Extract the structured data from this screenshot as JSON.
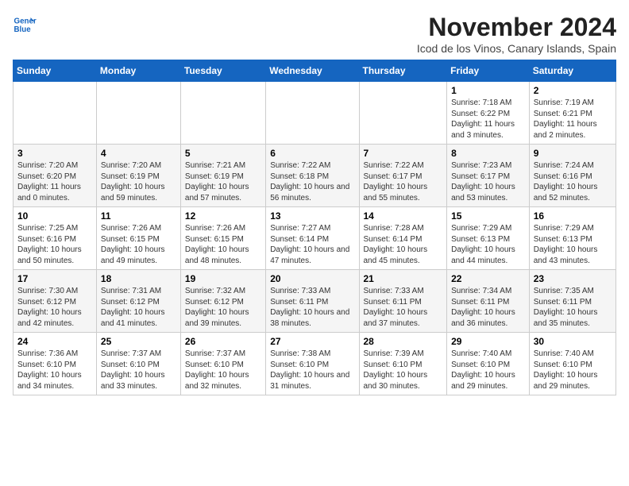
{
  "header": {
    "logo": {
      "line1": "General",
      "line2": "Blue"
    },
    "month": "November 2024",
    "location": "Icod de los Vinos, Canary Islands, Spain"
  },
  "weekdays": [
    "Sunday",
    "Monday",
    "Tuesday",
    "Wednesday",
    "Thursday",
    "Friday",
    "Saturday"
  ],
  "weeks": [
    [
      {
        "day": "",
        "info": ""
      },
      {
        "day": "",
        "info": ""
      },
      {
        "day": "",
        "info": ""
      },
      {
        "day": "",
        "info": ""
      },
      {
        "day": "",
        "info": ""
      },
      {
        "day": "1",
        "info": "Sunrise: 7:18 AM\nSunset: 6:22 PM\nDaylight: 11 hours and 3 minutes."
      },
      {
        "day": "2",
        "info": "Sunrise: 7:19 AM\nSunset: 6:21 PM\nDaylight: 11 hours and 2 minutes."
      }
    ],
    [
      {
        "day": "3",
        "info": "Sunrise: 7:20 AM\nSunset: 6:20 PM\nDaylight: 11 hours and 0 minutes."
      },
      {
        "day": "4",
        "info": "Sunrise: 7:20 AM\nSunset: 6:19 PM\nDaylight: 10 hours and 59 minutes."
      },
      {
        "day": "5",
        "info": "Sunrise: 7:21 AM\nSunset: 6:19 PM\nDaylight: 10 hours and 57 minutes."
      },
      {
        "day": "6",
        "info": "Sunrise: 7:22 AM\nSunset: 6:18 PM\nDaylight: 10 hours and 56 minutes."
      },
      {
        "day": "7",
        "info": "Sunrise: 7:22 AM\nSunset: 6:17 PM\nDaylight: 10 hours and 55 minutes."
      },
      {
        "day": "8",
        "info": "Sunrise: 7:23 AM\nSunset: 6:17 PM\nDaylight: 10 hours and 53 minutes."
      },
      {
        "day": "9",
        "info": "Sunrise: 7:24 AM\nSunset: 6:16 PM\nDaylight: 10 hours and 52 minutes."
      }
    ],
    [
      {
        "day": "10",
        "info": "Sunrise: 7:25 AM\nSunset: 6:16 PM\nDaylight: 10 hours and 50 minutes."
      },
      {
        "day": "11",
        "info": "Sunrise: 7:26 AM\nSunset: 6:15 PM\nDaylight: 10 hours and 49 minutes."
      },
      {
        "day": "12",
        "info": "Sunrise: 7:26 AM\nSunset: 6:15 PM\nDaylight: 10 hours and 48 minutes."
      },
      {
        "day": "13",
        "info": "Sunrise: 7:27 AM\nSunset: 6:14 PM\nDaylight: 10 hours and 47 minutes."
      },
      {
        "day": "14",
        "info": "Sunrise: 7:28 AM\nSunset: 6:14 PM\nDaylight: 10 hours and 45 minutes."
      },
      {
        "day": "15",
        "info": "Sunrise: 7:29 AM\nSunset: 6:13 PM\nDaylight: 10 hours and 44 minutes."
      },
      {
        "day": "16",
        "info": "Sunrise: 7:29 AM\nSunset: 6:13 PM\nDaylight: 10 hours and 43 minutes."
      }
    ],
    [
      {
        "day": "17",
        "info": "Sunrise: 7:30 AM\nSunset: 6:12 PM\nDaylight: 10 hours and 42 minutes."
      },
      {
        "day": "18",
        "info": "Sunrise: 7:31 AM\nSunset: 6:12 PM\nDaylight: 10 hours and 41 minutes."
      },
      {
        "day": "19",
        "info": "Sunrise: 7:32 AM\nSunset: 6:12 PM\nDaylight: 10 hours and 39 minutes."
      },
      {
        "day": "20",
        "info": "Sunrise: 7:33 AM\nSunset: 6:11 PM\nDaylight: 10 hours and 38 minutes."
      },
      {
        "day": "21",
        "info": "Sunrise: 7:33 AM\nSunset: 6:11 PM\nDaylight: 10 hours and 37 minutes."
      },
      {
        "day": "22",
        "info": "Sunrise: 7:34 AM\nSunset: 6:11 PM\nDaylight: 10 hours and 36 minutes."
      },
      {
        "day": "23",
        "info": "Sunrise: 7:35 AM\nSunset: 6:11 PM\nDaylight: 10 hours and 35 minutes."
      }
    ],
    [
      {
        "day": "24",
        "info": "Sunrise: 7:36 AM\nSunset: 6:10 PM\nDaylight: 10 hours and 34 minutes."
      },
      {
        "day": "25",
        "info": "Sunrise: 7:37 AM\nSunset: 6:10 PM\nDaylight: 10 hours and 33 minutes."
      },
      {
        "day": "26",
        "info": "Sunrise: 7:37 AM\nSunset: 6:10 PM\nDaylight: 10 hours and 32 minutes."
      },
      {
        "day": "27",
        "info": "Sunrise: 7:38 AM\nSunset: 6:10 PM\nDaylight: 10 hours and 31 minutes."
      },
      {
        "day": "28",
        "info": "Sunrise: 7:39 AM\nSunset: 6:10 PM\nDaylight: 10 hours and 30 minutes."
      },
      {
        "day": "29",
        "info": "Sunrise: 7:40 AM\nSunset: 6:10 PM\nDaylight: 10 hours and 29 minutes."
      },
      {
        "day": "30",
        "info": "Sunrise: 7:40 AM\nSunset: 6:10 PM\nDaylight: 10 hours and 29 minutes."
      }
    ]
  ]
}
